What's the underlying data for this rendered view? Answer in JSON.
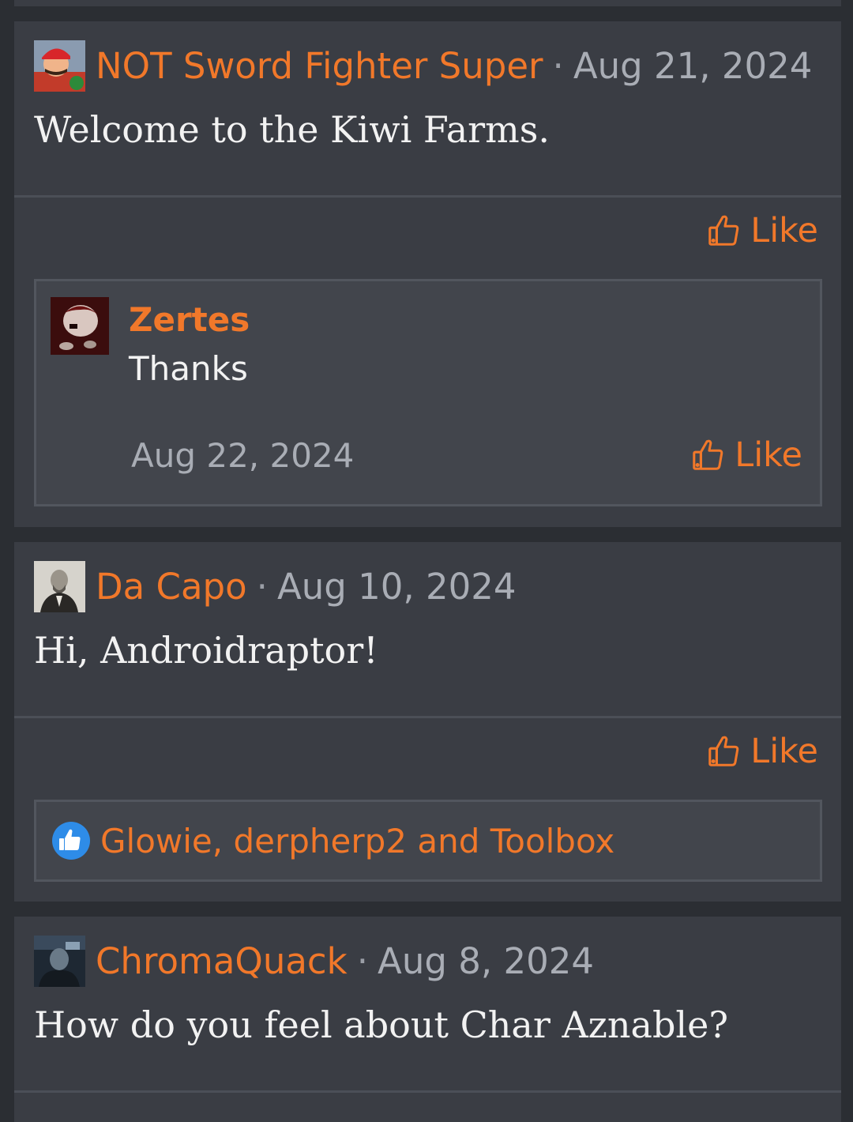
{
  "posts": [
    {
      "username": "NOT Sword Fighter Super",
      "date": "Aug 21, 2024",
      "body": "Welcome to the Kiwi Farms.",
      "like_label": "Like",
      "reply": {
        "username": "Zertes",
        "text": "Thanks",
        "date": "Aug 22, 2024",
        "like_label": "Like"
      }
    },
    {
      "username": "Da Capo",
      "date": "Aug 10, 2024",
      "body": "Hi, Androidraptor!",
      "like_label": "Like",
      "reactions": "Glowie, derpherp2 and Toolbox"
    },
    {
      "username": "ChromaQuack",
      "date": "Aug 8, 2024",
      "body": "How do you feel about Char Aznable?"
    }
  ],
  "separator": "·",
  "colors": {
    "accent": "#f1782a",
    "card": "#3a3d44",
    "background": "#2b2e33",
    "like_reaction": "#2e8ce8"
  },
  "icons": {
    "like": "thumbs-up-outline-icon",
    "reaction": "thumbs-up-filled-icon"
  }
}
